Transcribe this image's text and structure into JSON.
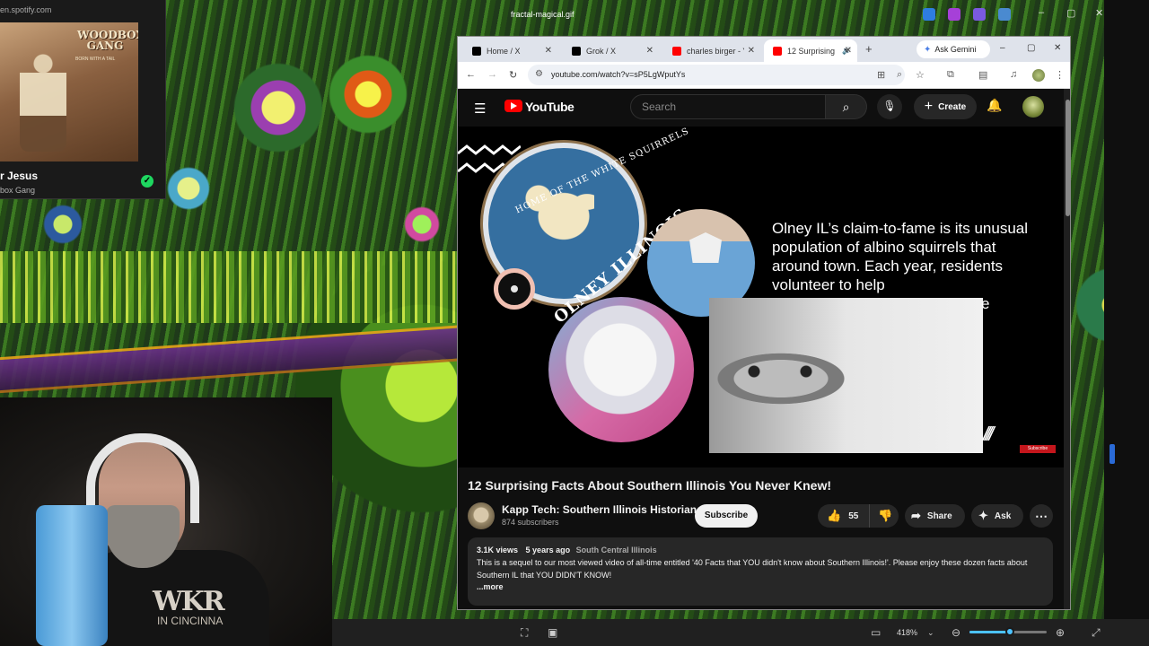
{
  "os": {
    "window_title": "fractal-magical.gif",
    "minimize": "–",
    "maximize": "▢",
    "close": "✕"
  },
  "spotify": {
    "url": "en.spotify.com",
    "album_title": "WOODBOX GANG",
    "album_subtitle": "BORN WITH A TAIL",
    "track": "r Jesus",
    "artist": "box Gang",
    "saved_check": "✓"
  },
  "webcam": {
    "shirt_text": "WKR",
    "shirt_small": "IN CINCINNA"
  },
  "chrome": {
    "tabs": [
      {
        "label": "Home / X",
        "favicon_color": "#000000"
      },
      {
        "label": "Grok / X",
        "favicon_color": "#000000"
      },
      {
        "label": "charles birger - Yo",
        "favicon_color": "#ff0000"
      },
      {
        "label": "12 Surprising",
        "favicon_color": "#ff0000"
      }
    ],
    "active_tab_audio": "🔊",
    "new_tab": "+",
    "gemini_label": "Ask Gemini",
    "url": "youtube.com/watch?v=sP5LgWputYs"
  },
  "youtube": {
    "logo_text": "YouTube",
    "search_placeholder": "Search",
    "create_label": "Create",
    "slide": {
      "seal_top": "HOME OF THE WHITE SQUIRRELS",
      "seal_bottom": "OLNEY ILLINOIS",
      "text": "Olney IL’s claim-to-fame is its unusual population of albino squirrels that around town. Each year, residents volunteer to help",
      "trailing": "e",
      "subscribe_badge": "Subscribe"
    },
    "video_title": "12 Surprising Facts About Southern Illinois You Never Knew!",
    "channel_name": "Kapp Tech: Southern Illinois Historian",
    "subscribers": "874 subscribers",
    "subscribe_label": "Subscribe",
    "likes": "55",
    "share_label": "Share",
    "ask_label": "Ask",
    "more": "⋯",
    "description": {
      "views": "3.1K views",
      "age": "5 years ago",
      "tag": "South Central Illinois",
      "text": "This is a sequel to our most viewed video of all-time entitled '40 Facts that YOU didn't know about Southern Illinois!'.  Please enjoy these dozen facts about Southern IL that YOU DIDN'T KNOW!",
      "more_label": "...more"
    }
  },
  "viewer": {
    "zoom": "418%",
    "zoom_fraction": 0.52
  },
  "colors": {
    "yt_bg": "#0f0f0f",
    "yt_red": "#ff0000",
    "accent_blue": "#4cc2ff",
    "spotify_green": "#1ed760"
  }
}
